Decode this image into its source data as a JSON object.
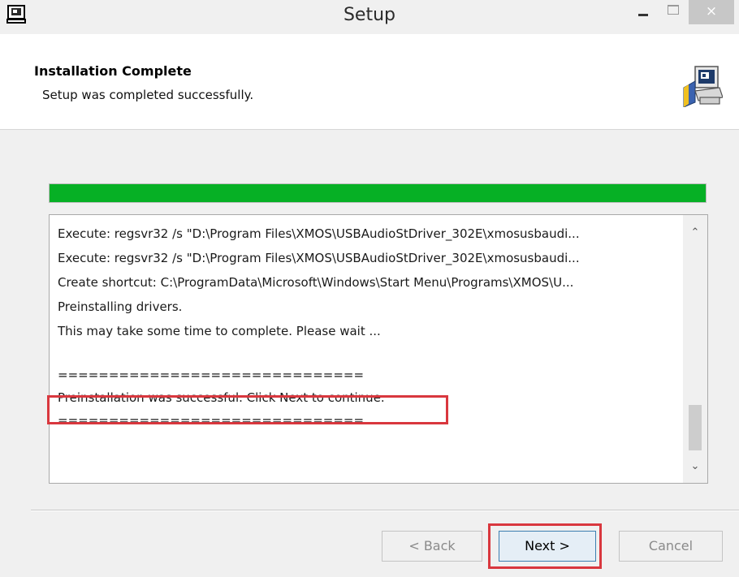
{
  "window": {
    "title": "Setup",
    "icon": "installer-computer-icon",
    "controls": {
      "minimize": "minimize-icon",
      "maximize": "maximize-icon",
      "close": "×"
    }
  },
  "header": {
    "title": "Installation Complete",
    "subtitle": "Setup was completed successfully.",
    "icon": "setup-computer-icon"
  },
  "progress": {
    "fraction": 1.0,
    "color": "#06b025"
  },
  "log": {
    "lines": [
      "Execute: regsvr32 /s \"D:\\Program Files\\XMOS\\USBAudioStDriver_302E\\xmosusbaudi...",
      "Execute: regsvr32 /s \"D:\\Program Files\\XMOS\\USBAudioStDriver_302E\\xmosusbaudi...",
      "Create shortcut: C:\\ProgramData\\Microsoft\\Windows\\Start Menu\\Programs\\XMOS\\U...",
      "Preinstalling drivers.",
      "This may take some time to complete. Please wait ...",
      "",
      "==============================",
      "Preinstallation was successful. Click Next to continue.",
      "=============================="
    ],
    "scroll_up": "^",
    "scroll_down": "v"
  },
  "buttons": {
    "back": "< Back",
    "next": "Next >",
    "cancel": "Cancel"
  },
  "colors": {
    "highlight": "#d9373e",
    "progress": "#06b025"
  }
}
